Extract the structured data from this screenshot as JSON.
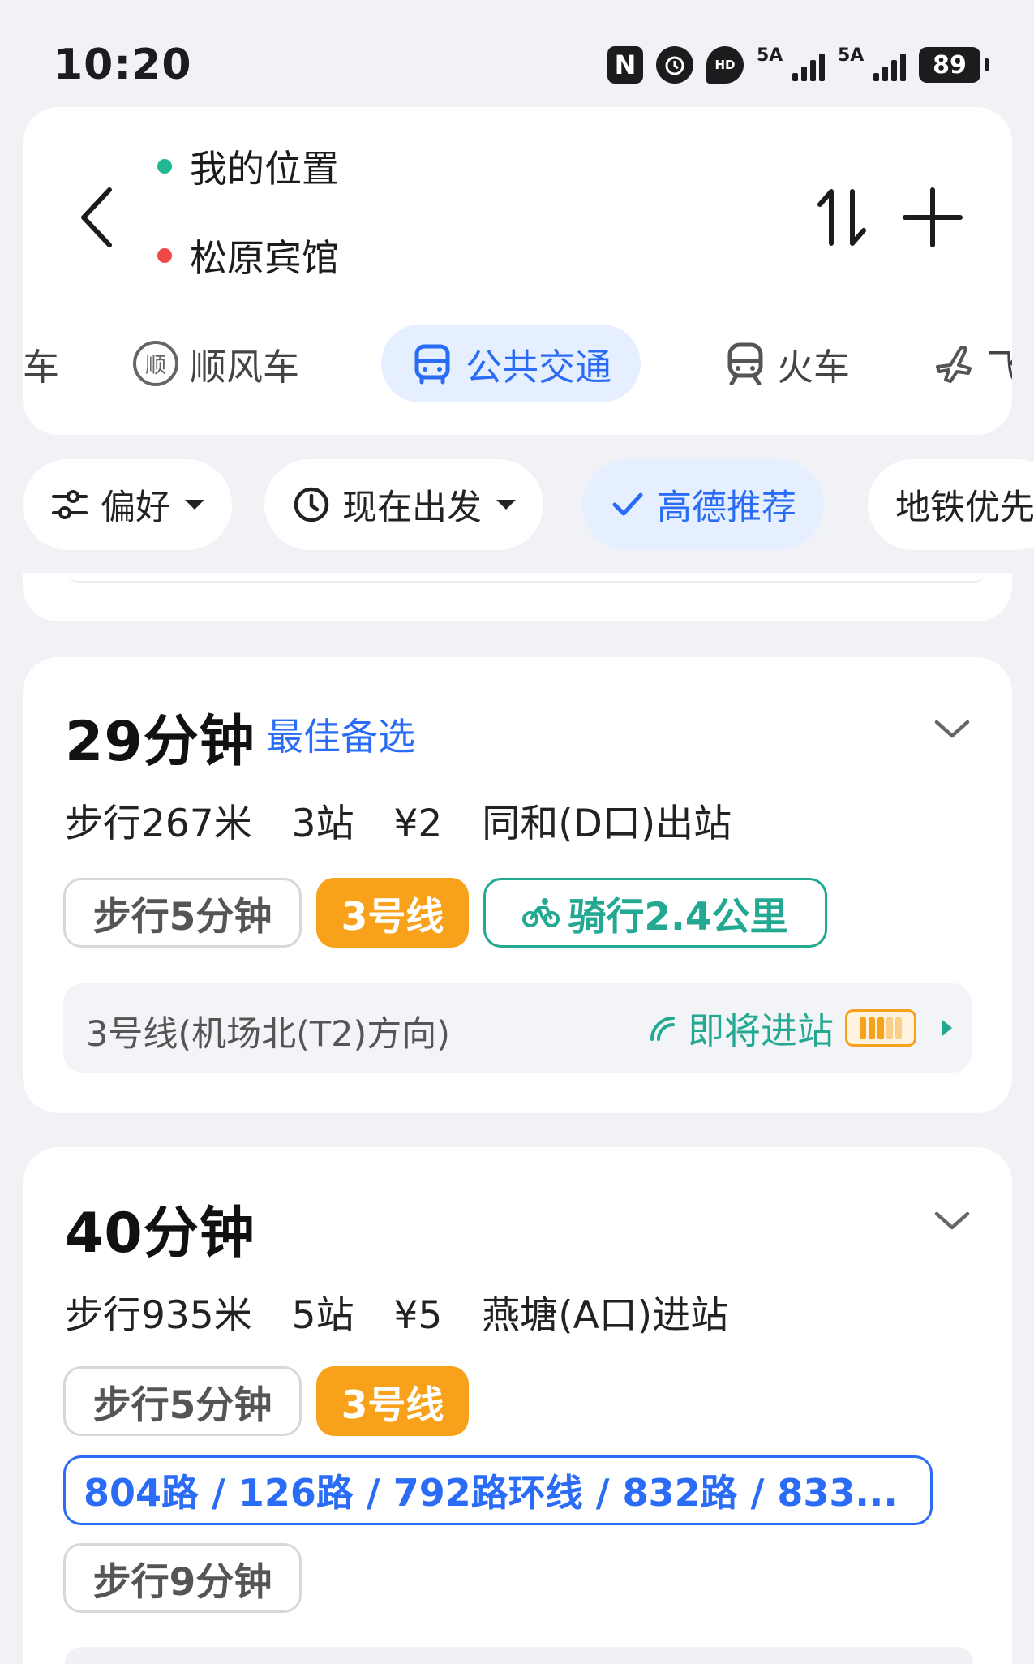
{
  "status_bar": {
    "time": "10:20",
    "sig1_label": "5A",
    "sig2_label": "5A",
    "battery": "89",
    "nfc_label": "N",
    "loc_label": "HD"
  },
  "route": {
    "from": "我的位置",
    "to": "松原宾馆",
    "from_color": "#20b893",
    "to_color": "#f04848"
  },
  "mode_tabs": [
    {
      "label": "车"
    },
    {
      "label": "顺风车",
      "icon_char": "顺"
    },
    {
      "label": "公共交通",
      "active": true
    },
    {
      "label": "火车"
    },
    {
      "label": "飞"
    }
  ],
  "filters": [
    {
      "label": "偏好"
    },
    {
      "label": "现在出发"
    },
    {
      "label": "高德推荐",
      "active": true
    },
    {
      "label": "地铁优先"
    }
  ],
  "routes": [
    {
      "duration": "29分钟",
      "badge": "最佳备选",
      "summary": [
        "步行267米",
        "3站",
        "¥2",
        "同和(D口)出站"
      ],
      "segments": [
        "步行5分钟",
        "3号线",
        "骑行2.4公里"
      ],
      "direction": "3号线(机场北(T2)方向)",
      "arrival": "即将进站"
    },
    {
      "duration": "40分钟",
      "summary": [
        "步行935米",
        "5站",
        "¥5",
        "燕塘(A口)进站"
      ],
      "segments": [
        "步行5分钟",
        "3号线",
        "804路 / 126路 / 792路环线 / 832路 / 833...",
        "步行9分钟"
      ]
    }
  ],
  "colors": {
    "accent_blue": "#2a6cf5",
    "line3_orange": "#f7a21a",
    "green": "#23a892"
  }
}
